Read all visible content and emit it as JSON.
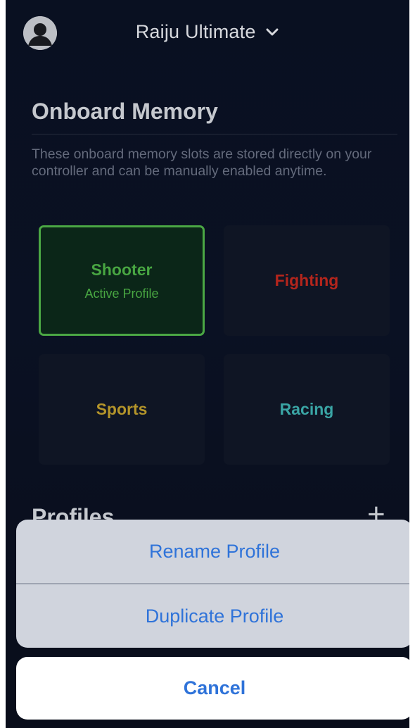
{
  "header": {
    "device_name": "Raiju Ultimate"
  },
  "onboard": {
    "title": "Onboard Memory",
    "description": "These onboard memory slots are stored directly on your controller and can be manually enabled anytime.",
    "slots": [
      {
        "name": "Shooter",
        "status": "Active Profile",
        "color": "#4fb548",
        "active": true
      },
      {
        "name": "Fighting",
        "status": "",
        "color": "#c4291f",
        "active": false
      },
      {
        "name": "Sports",
        "status": "",
        "color": "#c3a12e",
        "active": false
      },
      {
        "name": "Racing",
        "status": "",
        "color": "#3fb3b3",
        "active": false
      }
    ]
  },
  "profiles": {
    "title": "Profiles",
    "add_icon": "plus-icon"
  },
  "action_sheet": {
    "actions": [
      {
        "label": "Rename Profile"
      },
      {
        "label": "Duplicate Profile"
      }
    ],
    "cancel_label": "Cancel"
  },
  "colors": {
    "accent_blue": "#2f73d9",
    "active_green": "#4fb548",
    "background": "#0a1224"
  }
}
